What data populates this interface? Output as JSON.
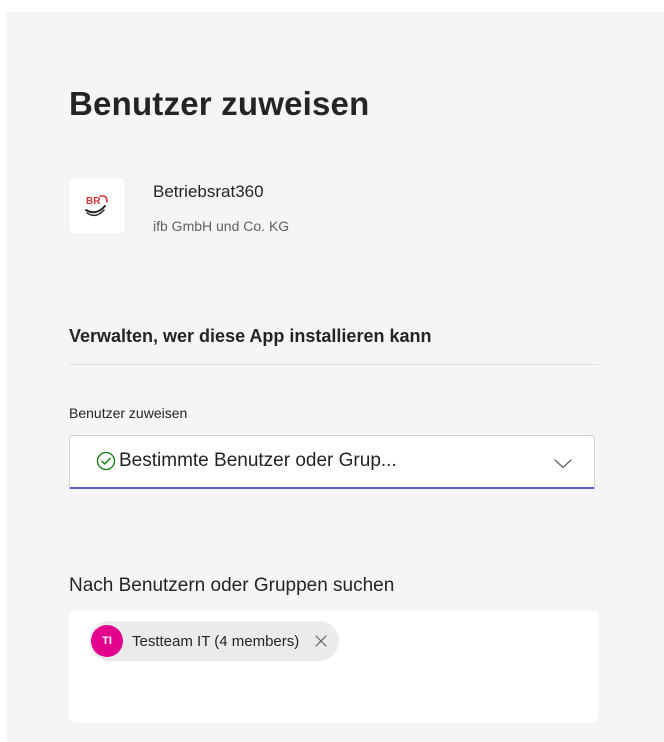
{
  "header": {
    "title": "Benutzer zuweisen"
  },
  "app": {
    "name": "Betriebsrat360",
    "publisher": "ifb GmbH und Co. KG",
    "logo_icon": "br-logo-icon",
    "logo_text": "BR"
  },
  "section": {
    "heading": "Verwalten, wer diese App installieren kann"
  },
  "assign": {
    "label": "Benutzer zuweisen",
    "selected_value": "Bestimmte Benutzer oder Grup...",
    "status_icon": "check-circle-icon",
    "dropdown_icon": "chevron-down-icon"
  },
  "search": {
    "label": "Nach Benutzern oder Gruppen suchen",
    "selected": [
      {
        "initials": "TI",
        "label": "Testteam IT (4 members)",
        "avatar_color": "#e3008c"
      }
    ],
    "remove_icon": "close-icon"
  },
  "colors": {
    "accent": "#5b5fc7",
    "success": "#107c10",
    "background": "#f5f5f5"
  }
}
